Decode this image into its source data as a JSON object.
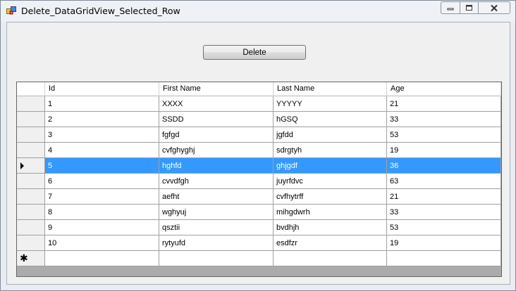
{
  "window": {
    "title": "Delete_DataGridView_Selected_Row"
  },
  "toolbar": {
    "delete_label": "Delete"
  },
  "grid": {
    "columns": [
      "Id",
      "First Name",
      "Last Name",
      "Age"
    ],
    "rows": [
      {
        "id": "1",
        "first_name": "XXXX",
        "last_name": "YYYYY",
        "age": "21"
      },
      {
        "id": "2",
        "first_name": "SSDD",
        "last_name": "hGSQ",
        "age": "33"
      },
      {
        "id": "3",
        "first_name": "fgfgd",
        "last_name": "jgfdd",
        "age": "53"
      },
      {
        "id": "4",
        "first_name": "cvfghyghj",
        "last_name": "sdrgtyh",
        "age": "19"
      },
      {
        "id": "5",
        "first_name": "hghfd",
        "last_name": "ghjgdf",
        "age": "36"
      },
      {
        "id": "6",
        "first_name": "cvvdfgh",
        "last_name": "juyrfdvc",
        "age": "63"
      },
      {
        "id": "7",
        "first_name": "aefht",
        "last_name": "cvfhytrff",
        "age": "21"
      },
      {
        "id": "8",
        "first_name": "wghyuj",
        "last_name": "mihgdwrh",
        "age": "33"
      },
      {
        "id": "9",
        "first_name": "qsztii",
        "last_name": "bvdhjh",
        "age": "53"
      },
      {
        "id": "10",
        "first_name": "rytyufd",
        "last_name": "esdfzr",
        "age": "19"
      }
    ],
    "selected_index": 4,
    "new_row_glyph": "✱"
  },
  "colors": {
    "selection": "#3399ff",
    "selection_text": "#ffffff"
  },
  "icons": [
    "app-icon",
    "minimize-icon",
    "maximize-icon",
    "close-icon",
    "current-row-arrow-icon",
    "new-row-asterisk-icon"
  ]
}
